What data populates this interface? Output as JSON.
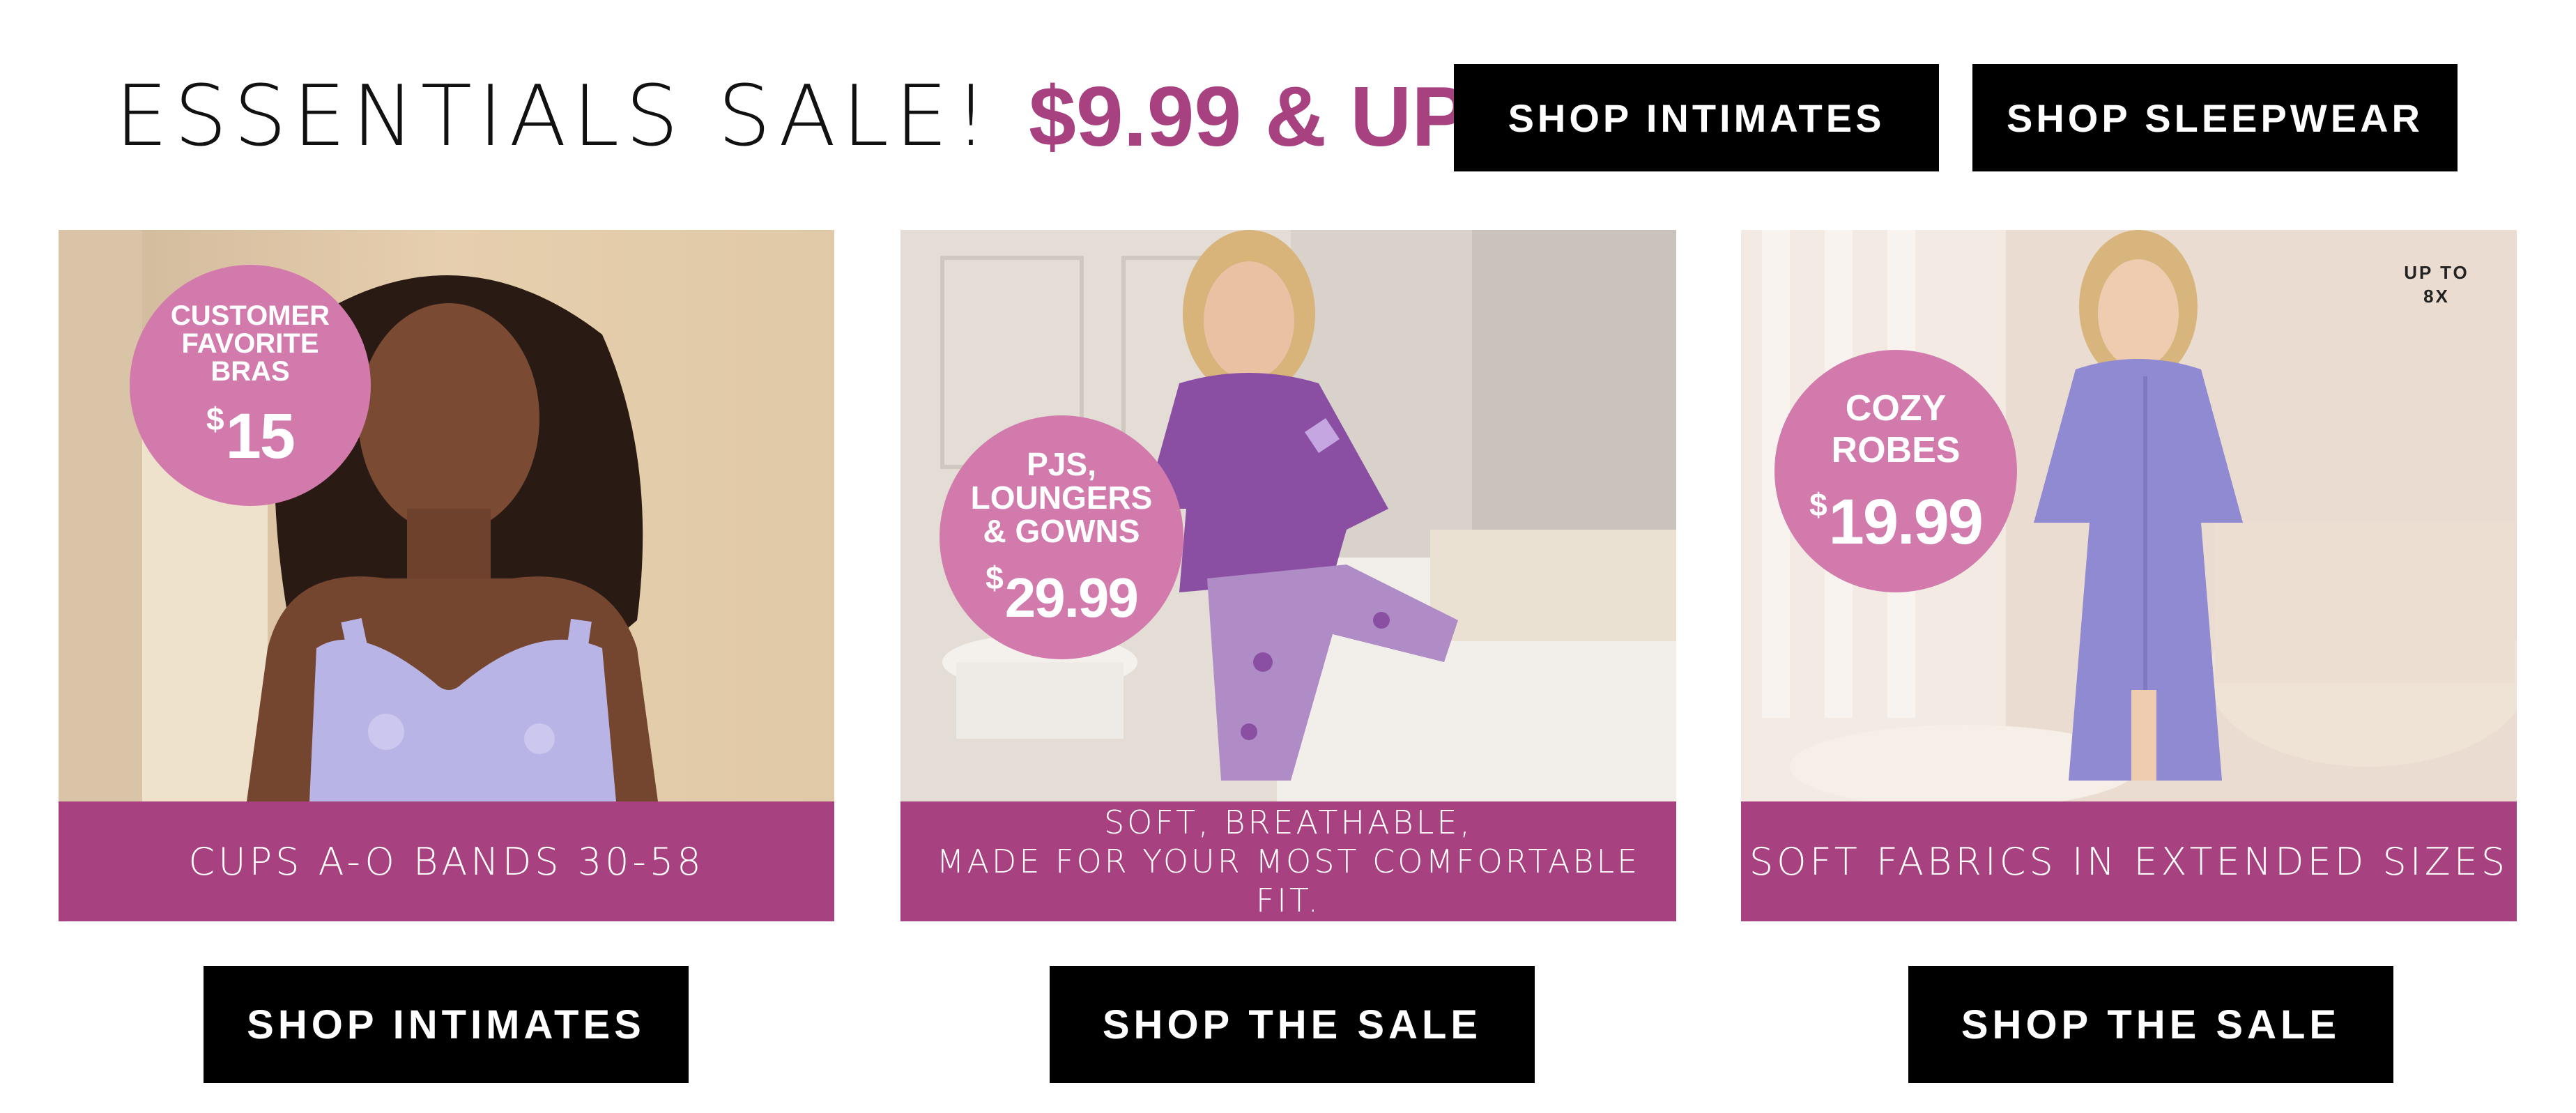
{
  "header": {
    "title_lead": "ESSENTIALS SALE!",
    "title_price": "$9.99 & UP",
    "buttons": [
      {
        "label": "SHOP INTIMATES"
      },
      {
        "label": "SHOP SLEEPWEAR"
      }
    ]
  },
  "cards": [
    {
      "badge": {
        "lines": [
          "CUSTOMER",
          "FAVORITE",
          "BRAS"
        ],
        "currency": "$",
        "price": "15"
      },
      "caption": [
        "CUPS A-O BANDS 30-58"
      ],
      "button": "SHOP INTIMATES"
    },
    {
      "badge": {
        "lines": [
          "PJS,",
          "LOUNGERS",
          "& GOWNS"
        ],
        "currency": "$",
        "price": "29.99"
      },
      "caption": [
        "SOFT, BREATHABLE,",
        "MADE FOR YOUR MOST COMFORTABLE FIT."
      ],
      "button": "SHOP THE SALE"
    },
    {
      "badge": {
        "lines": [
          "COZY",
          "ROBES"
        ],
        "currency": "$",
        "price": "19.99"
      },
      "note": [
        "UP TO",
        "8X"
      ],
      "caption": [
        "SOFT FABRICS IN EXTENDED SIZES"
      ],
      "button": "SHOP THE SALE"
    }
  ],
  "colors": {
    "accent": "#a8417f",
    "badge": "#d37aac",
    "button": "#000000",
    "text": "#111111"
  }
}
